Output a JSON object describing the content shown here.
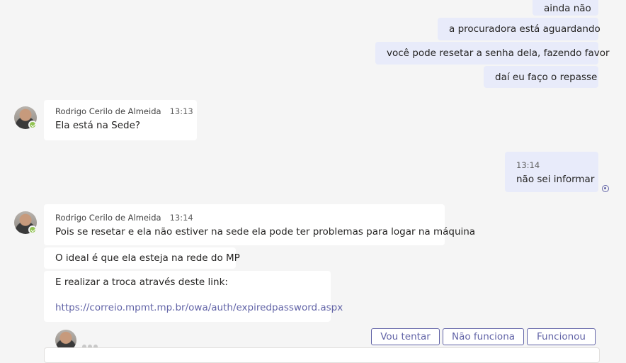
{
  "my_messages_top": [
    "ainda não",
    "a procuradora está aguardando",
    "você pode resetar a senha dela, fazendo favor",
    "daí eu faço o repasse"
  ],
  "msg1": {
    "author": "Rodrigo Cerilo de Almeida",
    "time": "13:13",
    "text": "Ela está na Sede?"
  },
  "my_msg2": {
    "time": "13:14",
    "text": "não sei informar"
  },
  "msg3": {
    "author": "Rodrigo Cerilo de Almeida",
    "time": "13:14",
    "text": "Pois se resetar e ela não estiver na sede ela pode ter problemas para logar na máquina",
    "text2": "O ideal é que ela esteja na rede do MP",
    "text3": "E realizar a troca através deste link:",
    "link": "https://correio.mpmt.mp.br/owa/auth/expiredpassword.aspx"
  },
  "suggested_replies": [
    "Vou tentar",
    "Não funciona",
    "Funcionou"
  ]
}
